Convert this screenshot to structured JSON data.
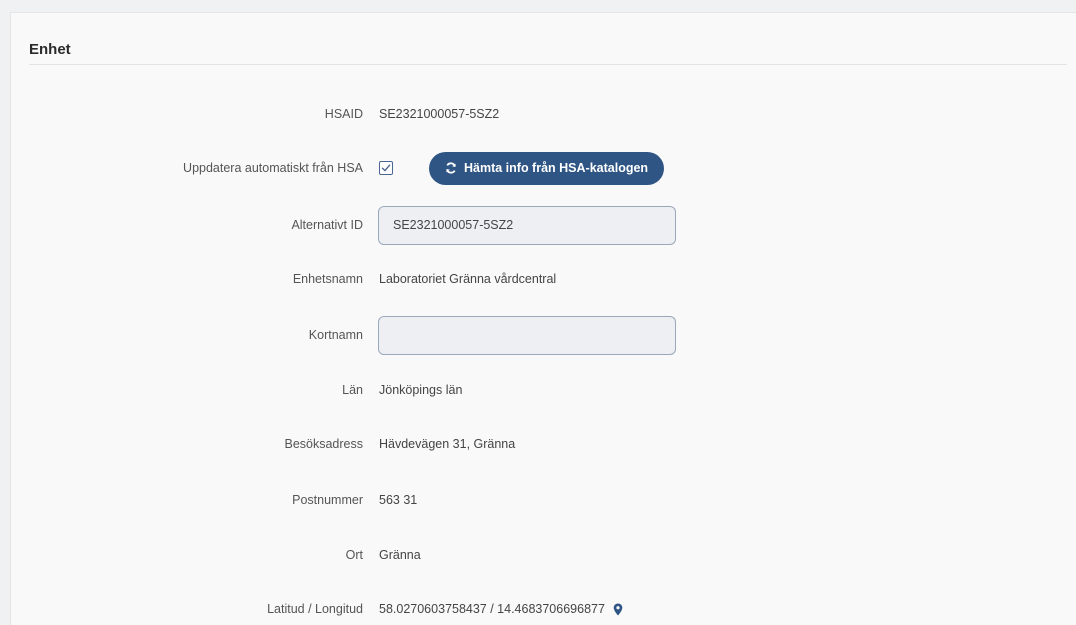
{
  "section": {
    "title": "Enhet"
  },
  "fields": {
    "hsaid": {
      "label": "HSAID",
      "value": "SE2321000057-5SZ2"
    },
    "auto_update": {
      "label": "Uppdatera automatiskt från HSA",
      "checked": true,
      "button_label": "Hämta info från HSA-katalogen"
    },
    "alt_id": {
      "label": "Alternativt ID",
      "value": "SE2321000057-5SZ2"
    },
    "unit_name": {
      "label": "Enhetsnamn",
      "value": "Laboratoriet Gränna vårdcentral"
    },
    "short_name": {
      "label": "Kortnamn",
      "value": ""
    },
    "county": {
      "label": "Län",
      "value": "Jönköpings län"
    },
    "visit_address": {
      "label": "Besöksadress",
      "value": "Hävdevägen 31, Gränna"
    },
    "postal_code": {
      "label": "Postnummer",
      "value": "563 31"
    },
    "city": {
      "label": "Ort",
      "value": "Gränna"
    },
    "coordinates": {
      "label": "Latitud / Longitud",
      "value": "58.0270603758437 / 14.4683706696877"
    }
  },
  "colors": {
    "primary": "#2f5584",
    "input_background": "#edeff3",
    "card_background": "#f9f9f9"
  },
  "icons": {
    "refresh": "refresh-icon",
    "check": "check-icon",
    "location": "map-pin-icon"
  }
}
